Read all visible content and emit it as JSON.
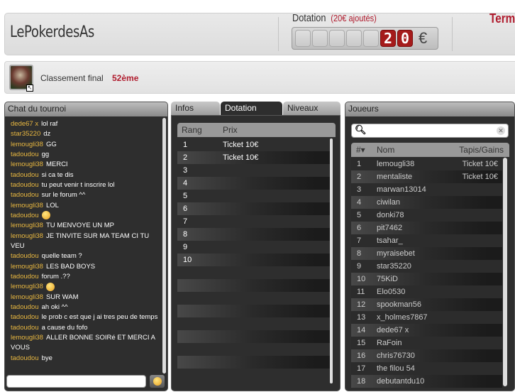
{
  "header": {
    "title": "LePokerdesAs",
    "dotation_label": "Dotation",
    "dotation_added": "(20€ ajoutés)",
    "digits": [
      "",
      "",
      "",
      "",
      "",
      "2",
      "0"
    ],
    "currency": "€",
    "status_partial": "Term"
  },
  "ranking": {
    "label": "Classement final",
    "value": "52ème"
  },
  "chat": {
    "title": "Chat du tournoi",
    "messages": [
      {
        "name": "dede67 x",
        "text": "lol raf"
      },
      {
        "name": "star35220",
        "text": "dz"
      },
      {
        "name": "lemougli38",
        "text": "GG"
      },
      {
        "name": "tadoudou",
        "text": "gg"
      },
      {
        "name": "lemougli38",
        "text": "MERCI"
      },
      {
        "name": "tadoudou",
        "text": "si ca te dis"
      },
      {
        "name": "tadoudou",
        "text": "tu peut venir t inscrire lol"
      },
      {
        "name": "tadoudou",
        "text": "sur le forum ^^"
      },
      {
        "name": "lemougli38",
        "text": "LOL"
      },
      {
        "name": "tadoudou",
        "text": "",
        "emoji": "tongue-emoji"
      },
      {
        "name": "lemougli38",
        "text": "TU MENVOYE UN MP"
      },
      {
        "name": "lemougli38",
        "text": "JE TINVITE SUR MA TEAM CI TU VEU"
      },
      {
        "name": "tadoudou",
        "text": "quelle team ?"
      },
      {
        "name": "lemougli38",
        "text": "LES BAD BOYS"
      },
      {
        "name": "tadoudou",
        "text": "forum .??"
      },
      {
        "name": "lemougli38",
        "text": "",
        "emoji": "grin-emoji"
      },
      {
        "name": "lemougli38",
        "text": "SUR WAM"
      },
      {
        "name": "tadoudou",
        "text": "ah oki ^^"
      },
      {
        "name": "tadoudou",
        "text": "le prob c est que j ai tres peu de temps"
      },
      {
        "name": "tadoudou",
        "text": "a cause du fofo"
      },
      {
        "name": "lemougli38",
        "text": "ALLER BONNE SOIRé ET MERCI A VOUS"
      },
      {
        "name": "tadoudou",
        "text": "bye"
      }
    ],
    "input_value": ""
  },
  "tabs": [
    {
      "label": "Infos",
      "active": false
    },
    {
      "label": "Dotation",
      "active": true
    },
    {
      "label": "Niveaux",
      "active": false
    }
  ],
  "dotation": {
    "headers": [
      "Rang",
      "Prix"
    ],
    "rows": [
      [
        "1",
        "Ticket 10€"
      ],
      [
        "2",
        "Ticket 10€"
      ],
      [
        "3",
        ""
      ],
      [
        "4",
        ""
      ],
      [
        "5",
        ""
      ],
      [
        "6",
        ""
      ],
      [
        "7",
        ""
      ],
      [
        "8",
        ""
      ],
      [
        "9",
        ""
      ],
      [
        "10",
        ""
      ]
    ]
  },
  "players": {
    "title": "Joueurs",
    "search_value": "",
    "headers": [
      "#▾",
      "Nom",
      "Tapis/Gains"
    ],
    "rows": [
      [
        "1",
        "lemougli38",
        "Ticket 10€"
      ],
      [
        "2",
        "mentaliste",
        "Ticket 10€"
      ],
      [
        "3",
        "marwan13014",
        ""
      ],
      [
        "4",
        "ciwilan",
        ""
      ],
      [
        "5",
        "donki78",
        ""
      ],
      [
        "6",
        "pit7462",
        ""
      ],
      [
        "7",
        "tsahar_",
        ""
      ],
      [
        "8",
        "myraisebet",
        ""
      ],
      [
        "9",
        "star35220",
        ""
      ],
      [
        "10",
        "75KiD",
        ""
      ],
      [
        "11",
        "Elo0530",
        ""
      ],
      [
        "12",
        "spookman56",
        ""
      ],
      [
        "13",
        "x_holmes7867",
        ""
      ],
      [
        "14",
        "dede67 x",
        ""
      ],
      [
        "15",
        "RaFoin",
        ""
      ],
      [
        "16",
        "chris76730",
        ""
      ],
      [
        "17",
        "the filou 54",
        ""
      ],
      [
        "18",
        "debutantdu10",
        ""
      ]
    ]
  }
}
